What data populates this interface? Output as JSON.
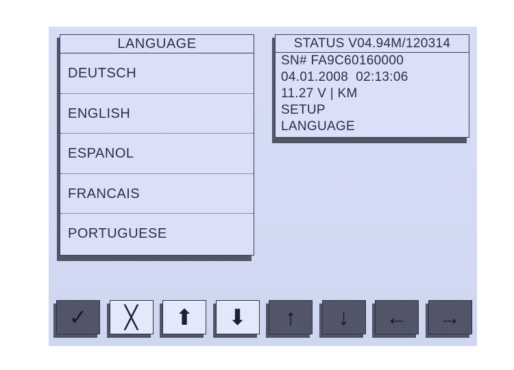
{
  "language_panel": {
    "title": "LANGUAGE",
    "items": [
      "DEUTSCH",
      "ENGLISH",
      "ESPANOL",
      "FRANCAIS",
      "PORTUGUESE"
    ]
  },
  "status_panel": {
    "title": "STATUS V04.94M/120314",
    "lines": [
      "SN# FA9C60160000",
      "04.01.2008  02:13:06",
      "11.27 V | KM",
      "SETUP",
      "LANGUAGE"
    ]
  },
  "buttons": [
    {
      "name": "confirm-button",
      "icon": "check-icon",
      "glyph": "✓",
      "style": "dark"
    },
    {
      "name": "cancel-button",
      "icon": "x-icon",
      "glyph": "╳",
      "style": "light"
    },
    {
      "name": "page-up-button",
      "icon": "bold-arrow-up-icon",
      "glyph": "⬆",
      "style": "light"
    },
    {
      "name": "page-down-button",
      "icon": "bold-arrow-down-icon",
      "glyph": "⬇",
      "style": "light"
    },
    {
      "name": "up-button",
      "icon": "arrow-up-icon",
      "glyph": "↑",
      "style": "dark"
    },
    {
      "name": "down-button",
      "icon": "arrow-down-icon",
      "glyph": "↓",
      "style": "dark"
    },
    {
      "name": "left-button",
      "icon": "arrow-left-icon",
      "glyph": "←",
      "style": "dark"
    },
    {
      "name": "right-button",
      "icon": "arrow-right-icon",
      "glyph": "→",
      "style": "dark"
    }
  ]
}
